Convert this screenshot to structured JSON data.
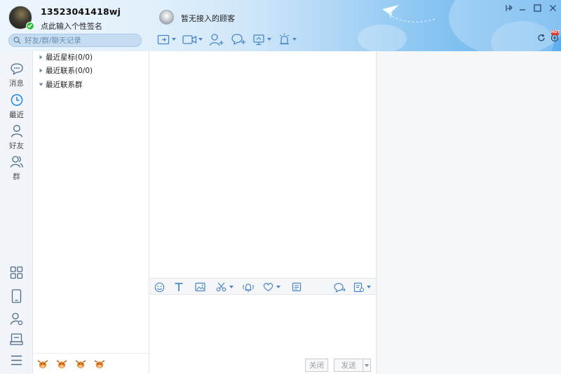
{
  "profile": {
    "username": "13523041418wj",
    "signature": "点此输入个性签名",
    "status": "online"
  },
  "search": {
    "placeholder": "好友/群/聊天记录"
  },
  "chat": {
    "contact_name": "暂无接入的顾客"
  },
  "nav": {
    "messages": "消息",
    "recent": "最近",
    "friends": "好友",
    "groups": "群"
  },
  "contacts": {
    "groups": [
      {
        "label": "最近星标(0/0)",
        "expanded": false
      },
      {
        "label": "最近联系(0/0)",
        "expanded": false
      },
      {
        "label": "最近联系群",
        "expanded": true
      }
    ]
  },
  "buttons": {
    "close": "关闭",
    "send": "发送"
  },
  "badges": {
    "hot": "HOT"
  },
  "colors": {
    "accent": "#2b8de0",
    "online": "#2dbe3a",
    "icon": "#4a86c6",
    "sidebar_icon": "#4d6b88"
  }
}
